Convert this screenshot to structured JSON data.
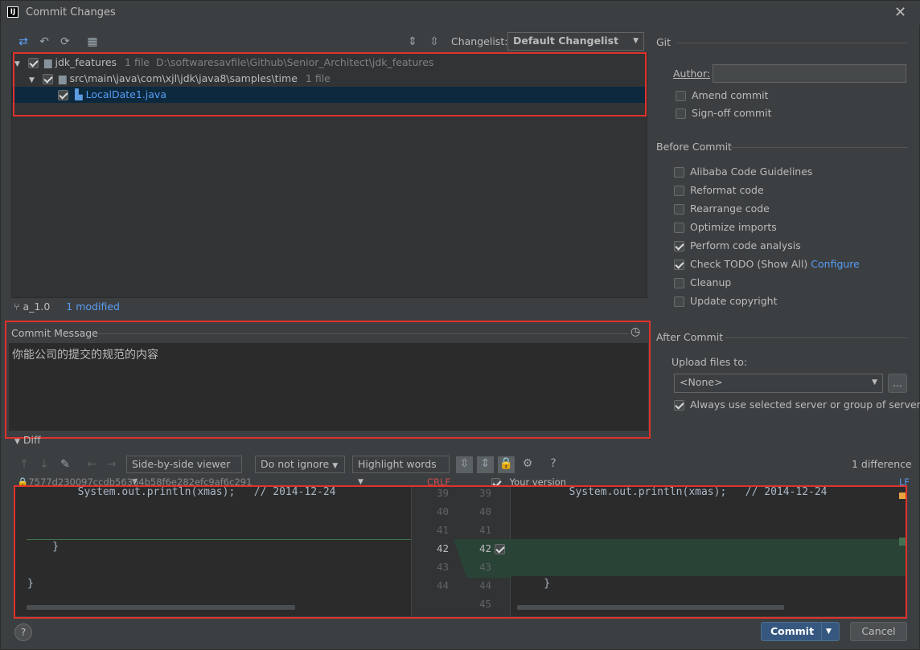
{
  "window": {
    "title": "Commit Changes"
  },
  "toolbar": {
    "changelist_label": "Changelist:",
    "changelist_value": "Default Changelist"
  },
  "tree": {
    "root": {
      "name": "jdk_features",
      "count": "1 file",
      "path": "D:\\softwaresavfile\\Github\\Senior_Architect\\jdk_features"
    },
    "folder": {
      "name": "src\\main\\java\\com\\xjl\\jdk\\java8\\samples\\time",
      "count": "1 file"
    },
    "file": {
      "name": "LocalDate1.java"
    }
  },
  "status": {
    "branch": "a_1.0",
    "modified": "1 modified"
  },
  "commit_message": {
    "label": "Commit Message",
    "text": "你能公司的提交的规范的内容"
  },
  "git": {
    "section": "Git",
    "author_label": "Author:",
    "author_value": "",
    "amend": "Amend commit",
    "signoff": "Sign-off commit"
  },
  "before_commit": {
    "section": "Before Commit",
    "items": [
      {
        "label": "Alibaba Code Guidelines",
        "checked": false
      },
      {
        "label": "Reformat code",
        "checked": false
      },
      {
        "label": "Rearrange code",
        "checked": false
      },
      {
        "label": "Optimize imports",
        "checked": false
      },
      {
        "label": "Perform code analysis",
        "checked": true
      },
      {
        "label": "Check TODO (Show All)",
        "checked": true,
        "link": "Configure"
      },
      {
        "label": "Cleanup",
        "checked": false
      },
      {
        "label": "Update copyright",
        "checked": false
      }
    ]
  },
  "after_commit": {
    "section": "After Commit",
    "upload_label": "Upload files to:",
    "upload_value": "<None>",
    "more": "...",
    "always_use": "Always use selected server or group of servers"
  },
  "diff": {
    "section": "Diff",
    "viewer": "Side-by-side viewer",
    "ignore": "Do not ignore",
    "highlight": "Highlight words",
    "help": "?",
    "count": "1 difference",
    "left_header": "7577d230097ccdb56364b58f6e282efc9af6c291",
    "left_sep": "CRLF",
    "right_header": "Your version",
    "right_sep": "LF",
    "left_lines": [
      {
        "n": "39",
        "code": "        System.out.println(xmas);   // 2014-12-24"
      },
      {
        "n": "40",
        "code": ""
      },
      {
        "n": "41",
        "code": ""
      },
      {
        "n": "42",
        "code": "    }"
      },
      {
        "n": "43",
        "code": ""
      },
      {
        "n": "44",
        "code": "}"
      }
    ],
    "right_lines": [
      {
        "n": "39",
        "code": "        System.out.println(xmas);   // 2014-12-24"
      },
      {
        "n": "40",
        "code": ""
      },
      {
        "n": "41",
        "code": ""
      },
      {
        "n": "42",
        "code": ""
      },
      {
        "n": "43",
        "code": ""
      },
      {
        "n": "44",
        "code": "    }"
      },
      {
        "n": "45",
        "code": ""
      }
    ]
  },
  "footer": {
    "help": "?",
    "commit": "Commit",
    "cancel": "Cancel"
  }
}
